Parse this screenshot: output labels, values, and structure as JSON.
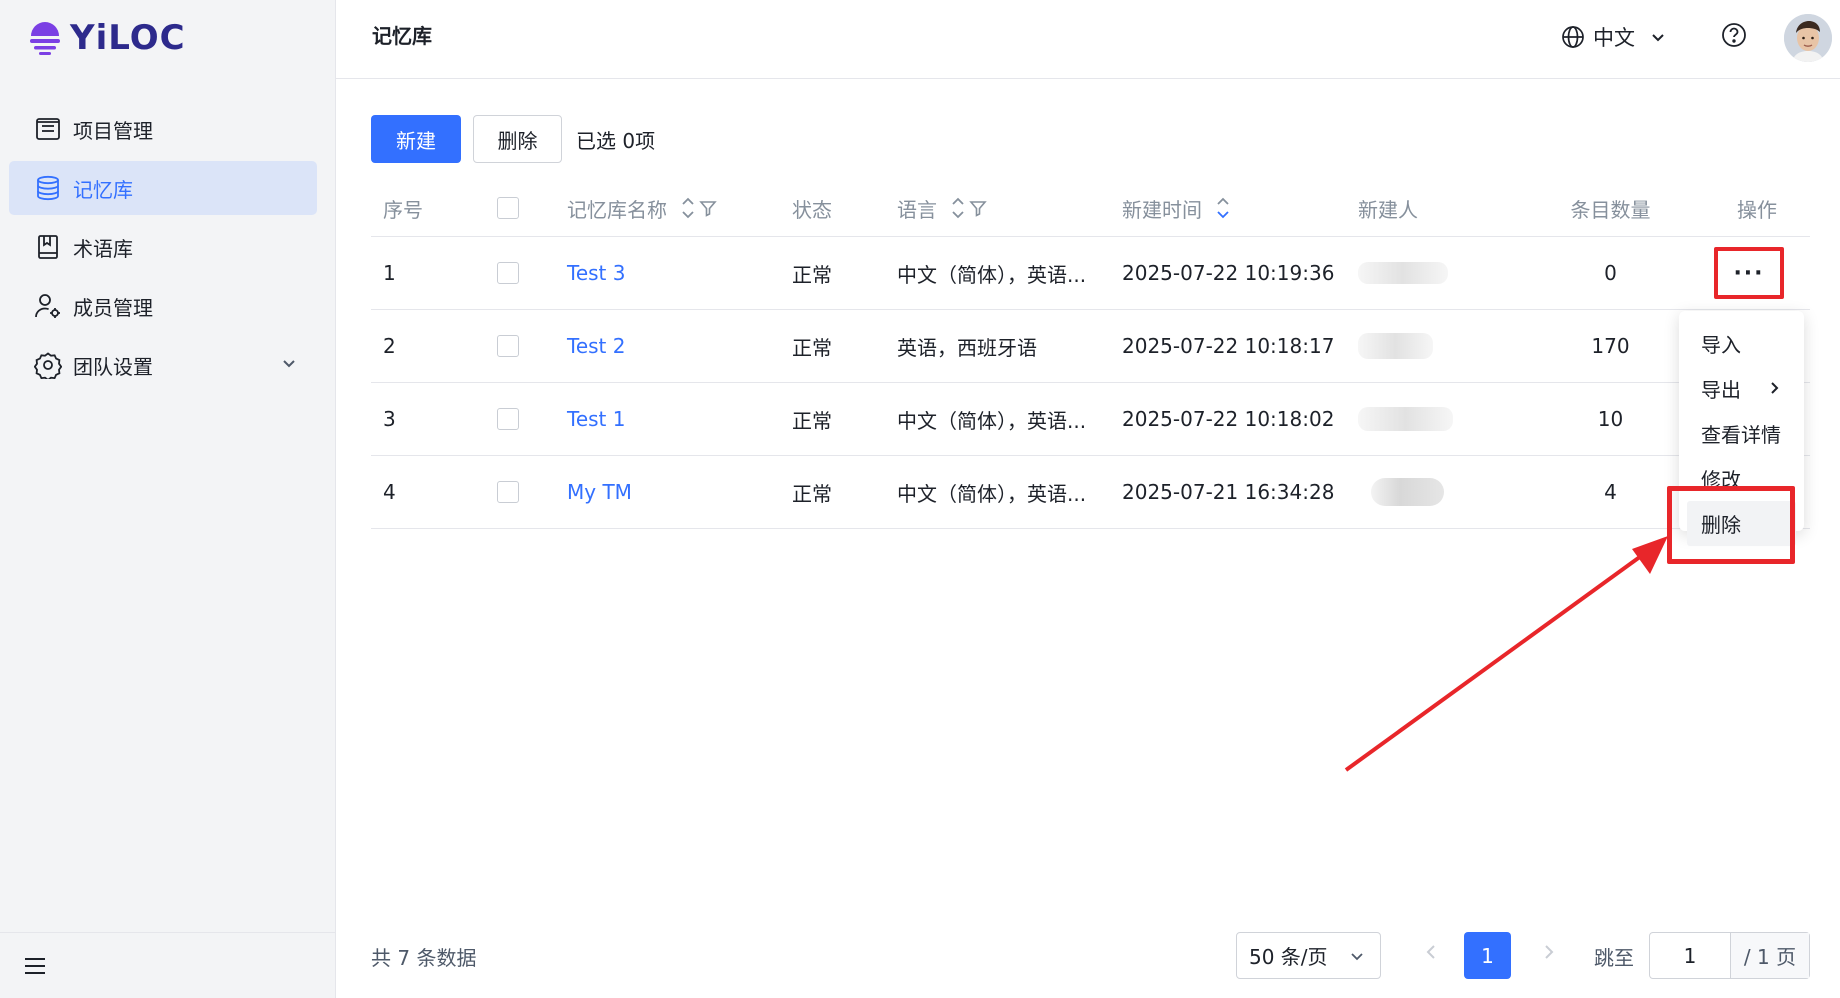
{
  "brand": {
    "name": "YiLOC"
  },
  "sidebar": {
    "items": [
      {
        "label": "项目管理",
        "icon": "list-icon"
      },
      {
        "label": "记忆库",
        "icon": "database-icon",
        "active": true
      },
      {
        "label": "术语库",
        "icon": "book-icon"
      },
      {
        "label": "成员管理",
        "icon": "user-settings-icon"
      },
      {
        "label": "团队设置",
        "icon": "gear-icon"
      }
    ],
    "collapse_icon": "hamburger-icon"
  },
  "header": {
    "title": "记忆库",
    "language": "中文",
    "help_icon": "help-circle-icon"
  },
  "toolbar": {
    "new_label": "新建",
    "delete_label": "删除",
    "selected_text": "已选 0项"
  },
  "table": {
    "columns": {
      "index": "序号",
      "name": "记忆库名称",
      "status": "状态",
      "language": "语言",
      "created_time": "新建时间",
      "creator": "新建人",
      "count": "条目数量",
      "actions": "操作"
    },
    "rows": [
      {
        "index": "1",
        "name": "Test 3",
        "status": "正常",
        "language": "中文（简体），英语...",
        "created_time": "2025-07-22 10:19:36",
        "count": "0"
      },
      {
        "index": "2",
        "name": "Test 2",
        "status": "正常",
        "language": "英语，西班牙语",
        "created_time": "2025-07-22 10:18:17",
        "count": "170"
      },
      {
        "index": "3",
        "name": "Test 1",
        "status": "正常",
        "language": "中文（简体），英语...",
        "created_time": "2025-07-22 10:18:02",
        "count": "10"
      },
      {
        "index": "4",
        "name": "My TM",
        "status": "正常",
        "language": "中文（简体），英语...",
        "created_time": "2025-07-21 16:34:28",
        "count": "4"
      }
    ],
    "more_label": "···"
  },
  "menu": {
    "items": [
      "导入",
      "导出",
      "查看详情",
      "修改",
      "删除"
    ]
  },
  "pagination": {
    "total_text": "共 7 条数据",
    "page_size": "50 条/页",
    "current_page": "1",
    "jump_label": "跳至",
    "jump_value": "1",
    "page_suffix": "/ 1 页"
  },
  "colors": {
    "accent": "#3370ff",
    "annotation": "#e8262a"
  }
}
